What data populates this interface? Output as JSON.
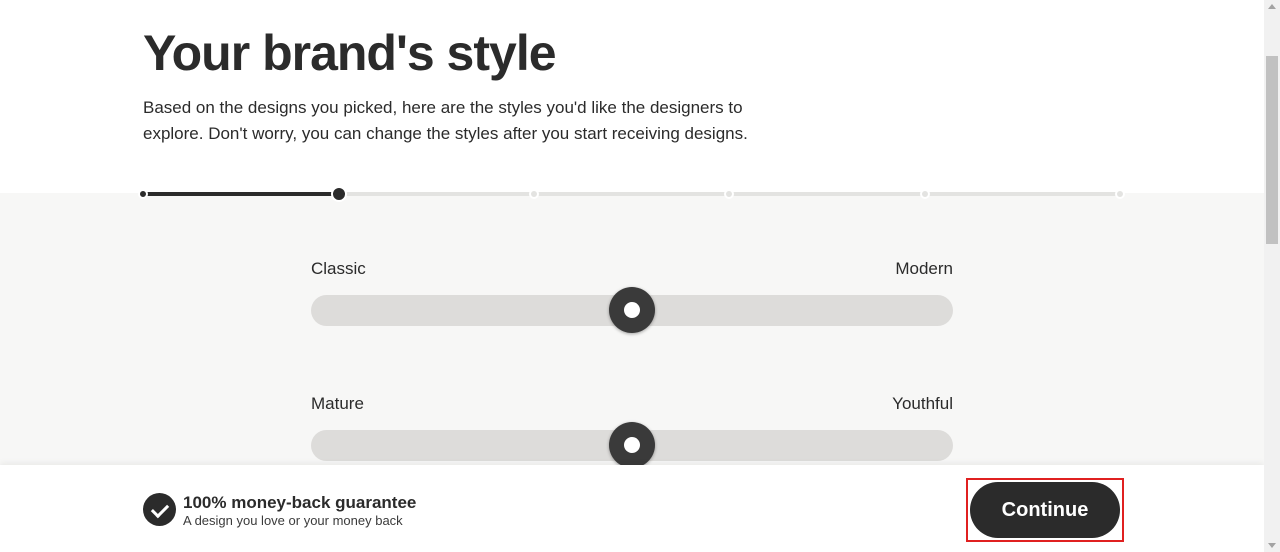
{
  "header": {
    "title": "Your brand's style",
    "description": "Based on the designs you picked, here are the styles you'd like the designers to explore. Don't worry, you can change the styles after you start receiving designs."
  },
  "progress": {
    "steps_total": 6,
    "current_step": 2
  },
  "sliders": [
    {
      "left_label": "Classic",
      "right_label": "Modern",
      "value": 0.5
    },
    {
      "left_label": "Mature",
      "right_label": "Youthful",
      "value": 0.5
    }
  ],
  "footer": {
    "guarantee_title": "100% money-back guarantee",
    "guarantee_subtitle": "A design you love or your money back",
    "continue_label": "Continue"
  },
  "colors": {
    "primary": "#2b2b2b",
    "background": "#f7f7f6",
    "highlight": "#e02020"
  },
  "icons": {
    "guarantee": "check-icon"
  }
}
